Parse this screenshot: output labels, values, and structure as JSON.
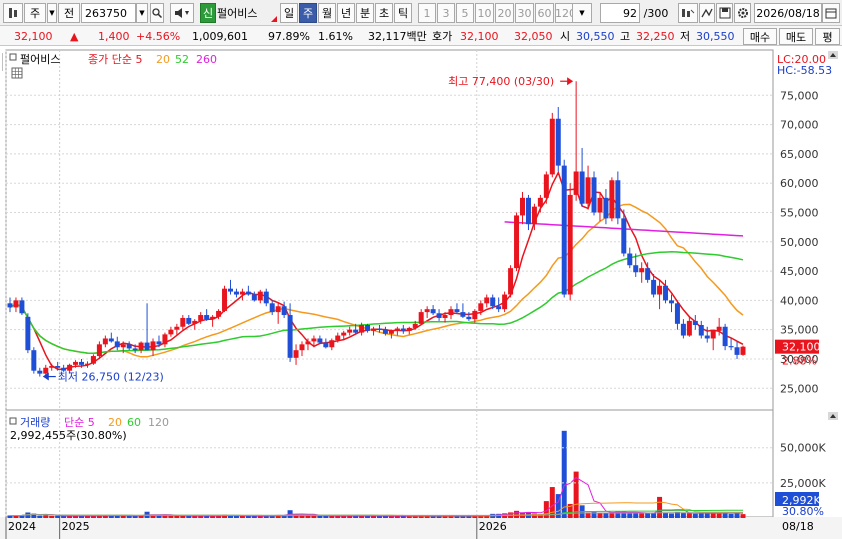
{
  "toolbar": {
    "market": "주",
    "prev": "전",
    "code": "263750",
    "stock_badge": "신",
    "stock_name": "펄어비스",
    "periods": [
      "일",
      "주",
      "월",
      "년",
      "분",
      "초",
      "틱"
    ],
    "active_period": "주",
    "intervals": [
      "1",
      "3",
      "5",
      "10",
      "20",
      "30",
      "60",
      "120"
    ],
    "count_value": "92",
    "count_total": "/300",
    "date": "2026/08/18"
  },
  "quote": {
    "price": "32,100",
    "arrow": "▲",
    "change": "1,400",
    "change_pct": "+4.56%",
    "volume": "1,009,601",
    "vol_ratio": "97.89%",
    "turnover": "1.61%",
    "amount": "32,117백만",
    "bid_label": "호가",
    "bid1": "32,100",
    "bid2": "32,050",
    "open_label": "시",
    "open": "30,550",
    "high_label": "고",
    "high": "32,250",
    "low_label": "저",
    "low": "30,550",
    "buy_label": "매수",
    "sell_label": "매도",
    "eval_label": "평"
  },
  "colors": {
    "up": "#e8141e",
    "down": "#1f4fd6",
    "ma5": "#e8141e",
    "ma20": "#f59a1e",
    "ma52": "#2ecc2e",
    "ma260": "#e020e0",
    "ma120": "#9a9a9a"
  },
  "chart_data": {
    "type": "candlestick",
    "title": "펄어비스",
    "legend": {
      "prefix": "종가 단순",
      "periods": [
        "5",
        "20",
        "52",
        "260"
      ]
    },
    "corner_labels": {
      "lc": "LC:20.00",
      "hc": "HC:-58.53"
    },
    "price_axis": {
      "ticks": [
        "75,000",
        "70,000",
        "65,000",
        "60,000",
        "55,000",
        "50,000",
        "45,000",
        "40,000",
        "35,000",
        "30,000",
        "25,000"
      ],
      "ylim": [
        23000,
        80000
      ]
    },
    "current_price": "32,100",
    "current_pct": "2.88%",
    "high_annotation": "최고 77,400 (03/30)",
    "low_annotation": "최저 26,750 (12/23)",
    "x_labels": [
      {
        "label": "2024",
        "index": 0
      },
      {
        "label": "2025",
        "index": 9
      },
      {
        "label": "2026",
        "index": 79
      }
    ],
    "date_end": "08/18",
    "candles": [
      [
        39500,
        40500,
        38000,
        38800
      ],
      [
        38800,
        40500,
        38000,
        40000
      ],
      [
        40000,
        40500,
        37500,
        37800
      ],
      [
        37200,
        37800,
        31000,
        31500
      ],
      [
        31500,
        32000,
        27500,
        28000
      ],
      [
        28000,
        28500,
        27000,
        27500
      ],
      [
        27500,
        29000,
        27000,
        28500
      ],
      [
        28500,
        29200,
        28000,
        28800
      ],
      [
        28800,
        29500,
        28000,
        28500
      ],
      [
        28500,
        29000,
        27800,
        28000
      ],
      [
        28000,
        29200,
        27500,
        29000
      ],
      [
        29000,
        29800,
        28500,
        29500
      ],
      [
        29500,
        30000,
        28500,
        29000
      ],
      [
        29000,
        29600,
        28500,
        29200
      ],
      [
        29200,
        30800,
        29000,
        30500
      ],
      [
        30500,
        33000,
        30000,
        32500
      ],
      [
        32500,
        34000,
        32000,
        33500
      ],
      [
        33500,
        34500,
        32800,
        33000
      ],
      [
        33000,
        33800,
        31500,
        32000
      ],
      [
        32000,
        33000,
        31000,
        32500
      ],
      [
        32500,
        33000,
        31500,
        31800
      ],
      [
        31800,
        32500,
        31000,
        31500
      ],
      [
        31500,
        33000,
        31000,
        32800
      ],
      [
        32800,
        39500,
        31500,
        31500
      ],
      [
        31500,
        33500,
        30500,
        33000
      ],
      [
        33000,
        34000,
        32000,
        32500
      ],
      [
        32500,
        34500,
        32000,
        34200
      ],
      [
        34200,
        35500,
        33800,
        35000
      ],
      [
        35000,
        36000,
        34000,
        35500
      ],
      [
        35500,
        37500,
        35000,
        37000
      ],
      [
        37000,
        37500,
        35800,
        36000
      ],
      [
        36000,
        36800,
        35000,
        36500
      ],
      [
        36500,
        38000,
        36000,
        37500
      ],
      [
        37500,
        38500,
        36500,
        36800
      ],
      [
        36800,
        37500,
        35500,
        37200
      ],
      [
        37200,
        38500,
        36800,
        38200
      ],
      [
        38200,
        42500,
        38000,
        42000
      ],
      [
        42000,
        43500,
        41000,
        41500
      ],
      [
        41500,
        42000,
        40500,
        41000
      ],
      [
        41000,
        42000,
        40000,
        41500
      ],
      [
        41500,
        42500,
        40800,
        41000
      ],
      [
        41000,
        41500,
        39800,
        40000
      ],
      [
        40000,
        41800,
        39500,
        41500
      ],
      [
        41500,
        42000,
        39000,
        39500
      ],
      [
        39500,
        40000,
        37500,
        38000
      ],
      [
        38000,
        39500,
        36000,
        39000
      ],
      [
        39000,
        39800,
        37000,
        37500
      ],
      [
        37500,
        39500,
        29500,
        30200
      ],
      [
        30200,
        32500,
        29000,
        31500
      ],
      [
        31500,
        33000,
        30500,
        32500
      ],
      [
        32500,
        33500,
        31500,
        33000
      ],
      [
        33000,
        34000,
        32000,
        33500
      ],
      [
        33500,
        34000,
        32500,
        32800
      ],
      [
        32800,
        33500,
        31800,
        32000
      ],
      [
        32000,
        33500,
        31500,
        33200
      ],
      [
        33200,
        34500,
        32800,
        34000
      ],
      [
        34000,
        34800,
        33200,
        34500
      ],
      [
        34500,
        35500,
        34000,
        35000
      ],
      [
        35000,
        36000,
        34200,
        34500
      ],
      [
        34500,
        36200,
        34000,
        35800
      ],
      [
        35800,
        36000,
        34500,
        34800
      ],
      [
        34800,
        35500,
        34000,
        35200
      ],
      [
        35200,
        35800,
        34500,
        35000
      ],
      [
        35000,
        35500,
        34000,
        34300
      ],
      [
        34300,
        35000,
        33500,
        34800
      ],
      [
        34800,
        35500,
        34000,
        35200
      ],
      [
        35200,
        35800,
        34300,
        34800
      ],
      [
        34800,
        35500,
        34200,
        35300
      ],
      [
        35300,
        36500,
        35000,
        36000
      ],
      [
        36000,
        38500,
        35800,
        38000
      ],
      [
        38000,
        39000,
        37000,
        38500
      ],
      [
        38500,
        39200,
        37500,
        37800
      ],
      [
        37800,
        38500,
        36500,
        37000
      ],
      [
        37000,
        38000,
        36200,
        37500
      ],
      [
        37500,
        39000,
        36800,
        38500
      ],
      [
        38500,
        39500,
        37800,
        38000
      ],
      [
        38000,
        39500,
        37000,
        37200
      ],
      [
        37200,
        38000,
        36500,
        36800
      ],
      [
        36800,
        38500,
        36200,
        38200
      ],
      [
        38200,
        40000,
        37500,
        39500
      ],
      [
        39500,
        41000,
        38800,
        40500
      ],
      [
        40500,
        41000,
        38500,
        39000
      ],
      [
        39000,
        40500,
        38000,
        38500
      ],
      [
        38500,
        41500,
        38000,
        41000
      ],
      [
        41000,
        46000,
        40500,
        45500
      ],
      [
        45500,
        55000,
        45000,
        54500
      ],
      [
        54500,
        58500,
        53000,
        57500
      ],
      [
        57500,
        58000,
        52000,
        53000
      ],
      [
        53000,
        56500,
        52000,
        56000
      ],
      [
        56000,
        58000,
        55000,
        57500
      ],
      [
        57500,
        62000,
        56500,
        61500
      ],
      [
        61500,
        72000,
        61000,
        71000
      ],
      [
        71000,
        73000,
        62000,
        63000
      ],
      [
        63000,
        64000,
        40500,
        41000
      ],
      [
        41000,
        60000,
        40000,
        58000
      ],
      [
        58000,
        77400,
        57000,
        62000
      ],
      [
        62000,
        66000,
        56000,
        56500
      ],
      [
        56500,
        63000,
        55500,
        61000
      ],
      [
        61000,
        62000,
        54500,
        55000
      ],
      [
        55000,
        58500,
        53500,
        57500
      ],
      [
        57500,
        59000,
        53000,
        54000
      ],
      [
        54000,
        61000,
        53500,
        60500
      ],
      [
        60500,
        62000,
        53000,
        54000
      ],
      [
        54000,
        55500,
        47500,
        48000
      ],
      [
        48000,
        49000,
        45500,
        46000
      ],
      [
        46000,
        48000,
        44000,
        44800
      ],
      [
        44800,
        46500,
        43000,
        45500
      ],
      [
        45500,
        46500,
        43000,
        43500
      ],
      [
        43500,
        44500,
        40500,
        41000
      ],
      [
        41000,
        43500,
        38500,
        42500
      ],
      [
        42500,
        43500,
        39500,
        40000
      ],
      [
        40000,
        41000,
        38000,
        39500
      ],
      [
        39500,
        40000,
        35000,
        36000
      ],
      [
        36000,
        36800,
        33500,
        34000
      ],
      [
        34000,
        37200,
        33800,
        36500
      ],
      [
        36500,
        37500,
        35000,
        35800
      ],
      [
        35800,
        36500,
        33500,
        34000
      ],
      [
        34000,
        35500,
        32800,
        33500
      ],
      [
        33500,
        35000,
        31500,
        34800
      ],
      [
        34800,
        37000,
        34000,
        35500
      ],
      [
        35500,
        36000,
        31500,
        32200
      ],
      [
        32200,
        33500,
        31500,
        32000
      ],
      [
        32000,
        33000,
        30000,
        30700
      ],
      [
        30700,
        32250,
        30550,
        32100
      ]
    ],
    "volume_axis": {
      "ticks": [
        "50,000K",
        "25,000K"
      ],
      "ylim": [
        0,
        64000
      ]
    },
    "volume_legend": {
      "title": "거래량",
      "prefix": "단순",
      "periods": [
        "5",
        "20",
        "60",
        "120"
      ]
    },
    "volume_info": "2,992,455주(30.80%)",
    "volume_current": "2,992K",
    "volume_current_pct": "30.80%"
  }
}
